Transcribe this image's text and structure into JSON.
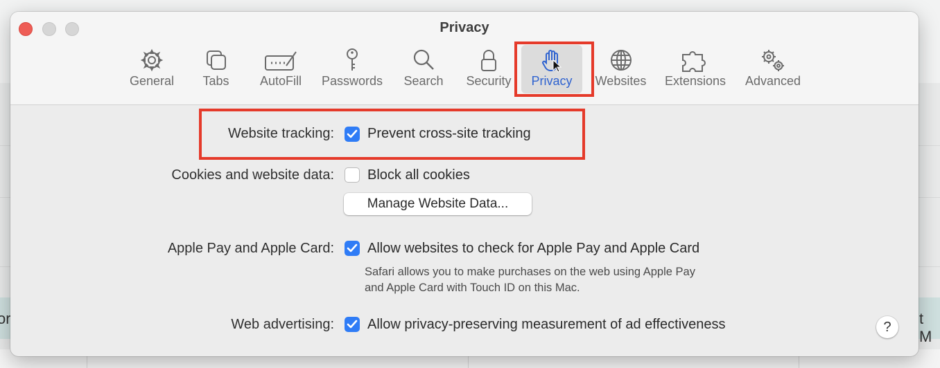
{
  "background": {
    "left_edge_text": "or",
    "right_edge_text": "t M"
  },
  "window": {
    "title": "Privacy",
    "tabs": [
      {
        "label": "General",
        "icon": "gear-icon"
      },
      {
        "label": "Tabs",
        "icon": "tabs-icon"
      },
      {
        "label": "AutoFill",
        "icon": "autofill-icon"
      },
      {
        "label": "Passwords",
        "icon": "key-icon"
      },
      {
        "label": "Search",
        "icon": "magnifier-icon"
      },
      {
        "label": "Security",
        "icon": "lock-icon"
      },
      {
        "label": "Privacy",
        "icon": "hand-icon",
        "selected": true
      },
      {
        "label": "Websites",
        "icon": "globe-icon"
      },
      {
        "label": "Extensions",
        "icon": "puzzle-icon"
      },
      {
        "label": "Advanced",
        "icon": "gears-icon"
      }
    ]
  },
  "settings": {
    "website_tracking": {
      "label": "Website tracking:",
      "option": "Prevent cross-site tracking",
      "checked": true
    },
    "cookies": {
      "label": "Cookies and website data:",
      "option": "Block all cookies",
      "checked": false,
      "button": "Manage Website Data..."
    },
    "apple_pay": {
      "label": "Apple Pay and Apple Card:",
      "option": "Allow websites to check for Apple Pay and Apple Card",
      "checked": true,
      "note_line1": "Safari allows you to make purchases on the web using Apple Pay",
      "note_line2": "and Apple Card with Touch ID on this Mac."
    },
    "web_advertising": {
      "label": "Web advertising:",
      "option": "Allow privacy-preserving measurement of ad effectiveness",
      "checked": true
    }
  },
  "help_button": "?",
  "colors": {
    "accent": "#2f7cf6",
    "selected_tab_text": "#2f63d0",
    "highlight": "#e53a2a",
    "close": "#ee5d56"
  }
}
